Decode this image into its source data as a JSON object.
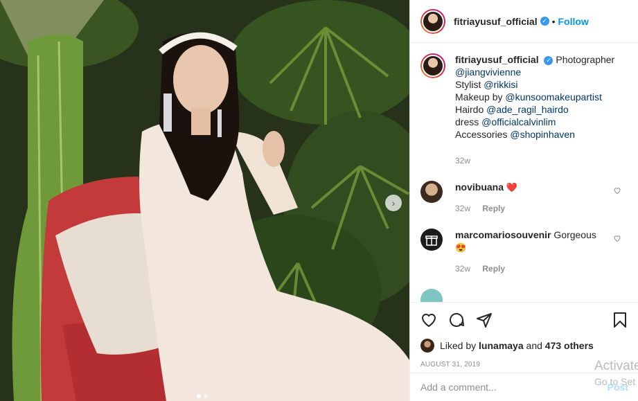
{
  "post": {
    "username": "fitriayusuf_official",
    "follow_label": "Follow",
    "separator": "•",
    "verified_symbol": "✓",
    "caption": {
      "label1": "Photographer",
      "mention1": "@jiangvivienne",
      "label2": "Stylist",
      "mention2": "@rikkisi",
      "label3": "Makeup by",
      "mention3": "@kunsoomakeupartist",
      "label4": "Hairdo",
      "mention4": "@ade_ragil_hairdo",
      "label5": "dress",
      "mention5": "@officialcalvinlim",
      "label6": "Accessories",
      "mention6": "@shopinhaven",
      "time": "32w"
    },
    "comments": [
      {
        "user": "novibuana",
        "text": "",
        "emoji": "❤️",
        "time": "32w",
        "reply": "Reply",
        "avatar_color": "#d4b08c"
      },
      {
        "user": "marcomariosouvenir",
        "text": "Gorgeous",
        "emoji": "😍",
        "time": "32w",
        "reply": "Reply",
        "avatar_color": "#1b1b1b"
      }
    ],
    "likes": {
      "prefix": "Liked by",
      "user": "lunamaya",
      "connector": "and",
      "count": "473 others"
    },
    "date": "AUGUST 31, 2019",
    "add_comment_placeholder": "Add a comment...",
    "post_label": "Post",
    "carousel": {
      "count": 2,
      "active": 1
    },
    "next_arrow": "›"
  },
  "watermark": {
    "line1": "Activate",
    "line2": "Go to Set"
  },
  "colors": {
    "link": "#0095f6",
    "verified": "#3897f0",
    "like_heart": "#ed4956"
  }
}
